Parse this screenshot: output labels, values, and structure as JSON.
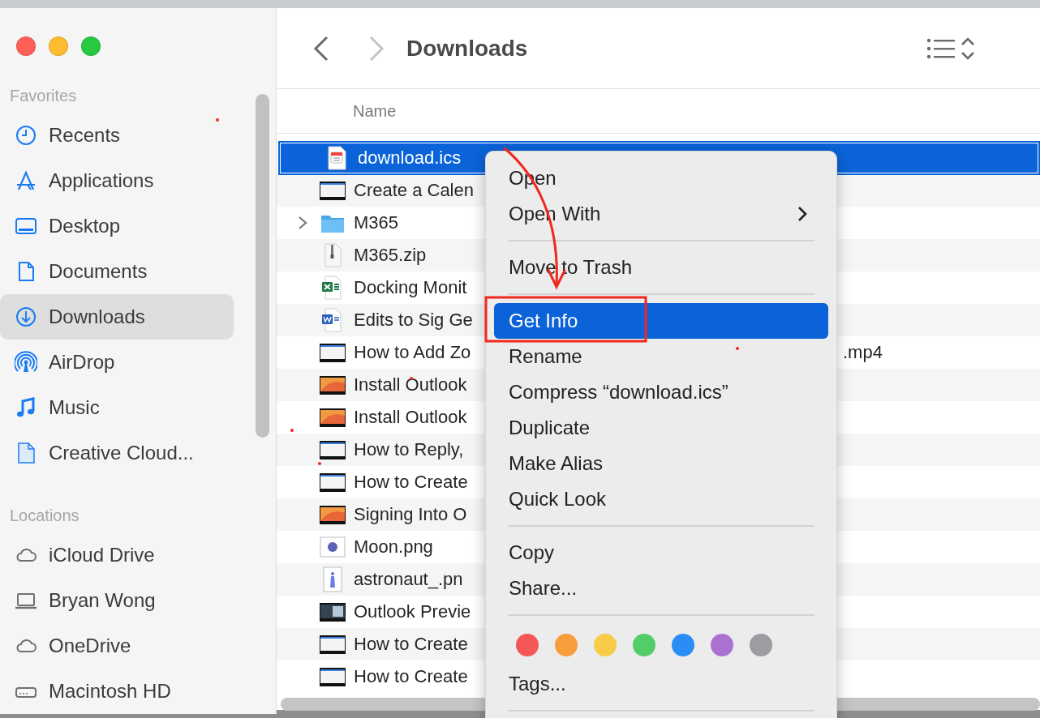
{
  "toolbar": {
    "title": "Downloads",
    "back_enabled": true,
    "forward_enabled": false
  },
  "sidebar": {
    "sections": [
      {
        "title": "Favorites",
        "items": [
          {
            "label": "Recents",
            "kind": "clock",
            "selected": false
          },
          {
            "label": "Applications",
            "kind": "apps",
            "selected": false
          },
          {
            "label": "Desktop",
            "kind": "desktop",
            "selected": false
          },
          {
            "label": "Documents",
            "kind": "document",
            "selected": false
          },
          {
            "label": "Downloads",
            "kind": "download",
            "selected": true
          },
          {
            "label": "AirDrop",
            "kind": "airdrop",
            "selected": false
          },
          {
            "label": "Music",
            "kind": "music",
            "selected": false
          },
          {
            "label": "Creative Cloud...",
            "kind": "cloudfile",
            "selected": false
          }
        ]
      },
      {
        "title": "Locations",
        "items": [
          {
            "label": "iCloud Drive",
            "kind": "cloud",
            "selected": false
          },
          {
            "label": "Bryan Wong",
            "kind": "laptop",
            "selected": false
          },
          {
            "label": "OneDrive",
            "kind": "cloud",
            "selected": false
          },
          {
            "label": "Macintosh HD",
            "kind": "drive",
            "selected": false
          }
        ]
      }
    ]
  },
  "file_list": {
    "columns": [
      "Name"
    ],
    "rows": [
      {
        "name": "download.ics",
        "kind": "calendar",
        "selected": true
      },
      {
        "name": "Create a Calen",
        "kind": "thumb-light",
        "selected": false
      },
      {
        "name": "M365",
        "kind": "folder",
        "selected": false,
        "expanded": false
      },
      {
        "name": "M365.zip",
        "kind": "zip",
        "selected": false
      },
      {
        "name": "Docking Monit",
        "kind": "sheet",
        "selected": false
      },
      {
        "name": "Edits to Sig Ge",
        "kind": "doc",
        "selected": false
      },
      {
        "name": "How to Add Zo",
        "tail": ".mp4",
        "kind": "thumb-light",
        "selected": false
      },
      {
        "name": "Install Outlook",
        "kind": "thumb-orange",
        "selected": false
      },
      {
        "name": "Install Outlook",
        "kind": "thumb-orange",
        "selected": false
      },
      {
        "name": "How to Reply,",
        "kind": "thumb-light",
        "selected": false
      },
      {
        "name": "How to Create",
        "kind": "thumb-light",
        "selected": false
      },
      {
        "name": "Signing Into O",
        "kind": "thumb-orange",
        "selected": false
      },
      {
        "name": "Moon.png",
        "kind": "moon",
        "selected": false
      },
      {
        "name": "astronaut_.pn",
        "kind": "figure",
        "selected": false
      },
      {
        "name": "Outlook Previe",
        "kind": "thumb-dark",
        "selected": false
      },
      {
        "name": "How to Create",
        "kind": "thumb-light",
        "selected": false
      },
      {
        "name": "How to Create",
        "kind": "thumb-light",
        "selected": false
      }
    ]
  },
  "context_menu": {
    "items": [
      {
        "kind": "item",
        "label": "Open",
        "selected": false
      },
      {
        "kind": "submenu",
        "label": "Open With",
        "selected": false
      },
      {
        "kind": "separator"
      },
      {
        "kind": "item",
        "label": "Move to Trash",
        "selected": false
      },
      {
        "kind": "separator"
      },
      {
        "kind": "item",
        "label": "Get Info",
        "selected": true
      },
      {
        "kind": "item",
        "label": "Rename",
        "selected": false
      },
      {
        "kind": "item",
        "label": "Compress “download.ics”",
        "selected": false
      },
      {
        "kind": "item",
        "label": "Duplicate",
        "selected": false
      },
      {
        "kind": "item",
        "label": "Make Alias",
        "selected": false
      },
      {
        "kind": "item",
        "label": "Quick Look",
        "selected": false
      },
      {
        "kind": "separator"
      },
      {
        "kind": "item",
        "label": "Copy",
        "selected": false
      },
      {
        "kind": "item",
        "label": "Share...",
        "selected": false
      },
      {
        "kind": "separator"
      },
      {
        "kind": "tags",
        "dots": [
          {
            "color": "#f55656"
          },
          {
            "color": "#f79d3c"
          },
          {
            "color": "#f8cc48"
          },
          {
            "color": "#52cd67"
          },
          {
            "color": "#2a8df5"
          },
          {
            "color": "#ac72d1"
          },
          {
            "color": "#9d9ca1"
          }
        ]
      },
      {
        "kind": "item",
        "label": "Tags...",
        "selected": false
      },
      {
        "kind": "separator"
      }
    ]
  }
}
